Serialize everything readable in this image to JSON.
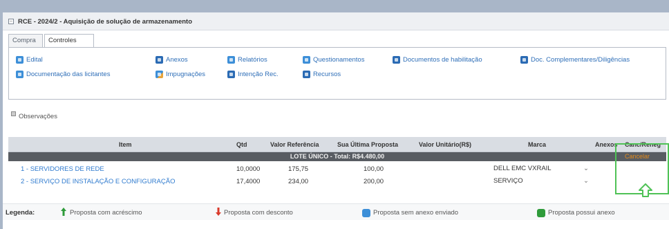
{
  "title": "RCE - 2024/2 - Aquisição de solução de armazenamento",
  "tabs": [
    "Compra",
    "Controles"
  ],
  "links": {
    "edital": "Edital",
    "anexos": "Anexos",
    "relatorios": "Relatórios",
    "questionamentos": "Questionamentos",
    "documentos_habilitacao": "Documentos de habilitação",
    "doc_complementares": "Doc. Complementares/Diligências",
    "documentacao_licitantes": "Documentação das licitantes",
    "impugnacoes": "Impugnações",
    "intencao_rec": "Intenção Rec.",
    "recursos": "Recursos"
  },
  "observacoes": "Observações",
  "table": {
    "headers": {
      "item": "Item",
      "qtd": "Qtd",
      "valor_referencia": "Valor Referência",
      "sua_ultima_proposta": "Sua Última Proposta",
      "valor_unitario": "Valor Unitário(R$)",
      "marca": "Marca",
      "anexos": "Anexos",
      "canc_reneg": "Canc/Reneg"
    },
    "lote": "LOTE ÚNICO  -  Total: R$4.480,00",
    "cancelar": "Cancelar",
    "rows": [
      {
        "item": "1 - SERVIDORES DE REDE",
        "qtd": "10,0000",
        "valor_referencia": "175,75",
        "ultima_proposta": "100,00",
        "marca": "DELL EMC VXRAIL"
      },
      {
        "item": "2 - SERVIÇO DE INSTALAÇÃO E CONFIGURAÇÃO",
        "qtd": "17,4000",
        "valor_referencia": "234,00",
        "ultima_proposta": "200,00",
        "marca": "SERVIÇO"
      }
    ]
  },
  "legend": {
    "label": "Legenda:",
    "acrescimo": "Proposta com acréscimo",
    "desconto": "Proposta com desconto",
    "sem_anexo": "Proposta sem anexo enviado",
    "possui_anexo": "Proposta possui anexo"
  },
  "colors": {
    "link": "#2f6fb8",
    "lote_bar": "#585c62",
    "cancel": "#e38b1d",
    "highlight": "#4fc256",
    "arrow_up": "#2e9b3a",
    "arrow_down": "#d93a2b"
  }
}
